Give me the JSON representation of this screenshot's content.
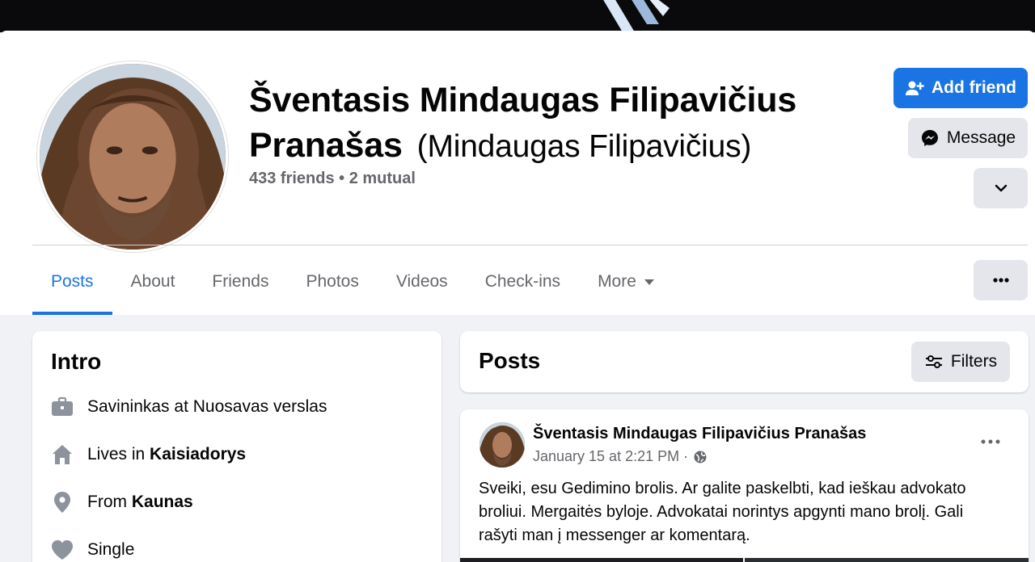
{
  "colors": {
    "accent": "#1b74e4",
    "secondary_button": "#e4e6eb",
    "muted_text": "#65676b",
    "page_background": "#f0f2f5"
  },
  "profile": {
    "name": "Šventasis Mindaugas Filipavičius Pranašas",
    "alternate_name": "(Mindaugas Filipavičius)",
    "friends_summary": "433 friends • 2 mutual"
  },
  "actions": {
    "add_friend_label": "Add friend",
    "add_friend_icon": "person-plus-icon",
    "message_label": "Message",
    "message_icon": "messenger-icon",
    "more_icon": "chevron-down-icon"
  },
  "tabs": [
    {
      "label": "Posts",
      "active": true
    },
    {
      "label": "About"
    },
    {
      "label": "Friends"
    },
    {
      "label": "Photos"
    },
    {
      "label": "Videos"
    },
    {
      "label": "Check-ins"
    },
    {
      "label": "More",
      "has_caret": true
    }
  ],
  "intro": {
    "title": "Intro",
    "items": [
      {
        "icon": "briefcase-icon",
        "prefix": "Savininkas at Nuosavas verslas",
        "value": ""
      },
      {
        "icon": "home-icon",
        "prefix": "Lives in ",
        "value": "Kaisiadorys"
      },
      {
        "icon": "location-pin-icon",
        "prefix": "From ",
        "value": "Kaunas"
      },
      {
        "icon": "heart-icon",
        "prefix": "Single",
        "value": ""
      }
    ]
  },
  "posts_section": {
    "title": "Posts",
    "filters_label": "Filters",
    "filters_icon": "sliders-icon"
  },
  "post": {
    "author": "Šventasis Mindaugas Filipavičius Pranašas",
    "timestamp": "January 15 at 2:21 PM ·",
    "audience_icon": "globe-icon",
    "text": "Sveiki, esu Gedimino brolis. Ar galite paskelbti, kad ieškau advokato broliui. Mergaitės byloje. Advokatai norintys apgynti mano brolį. Gali rašyti man į messenger ar komentarą."
  }
}
